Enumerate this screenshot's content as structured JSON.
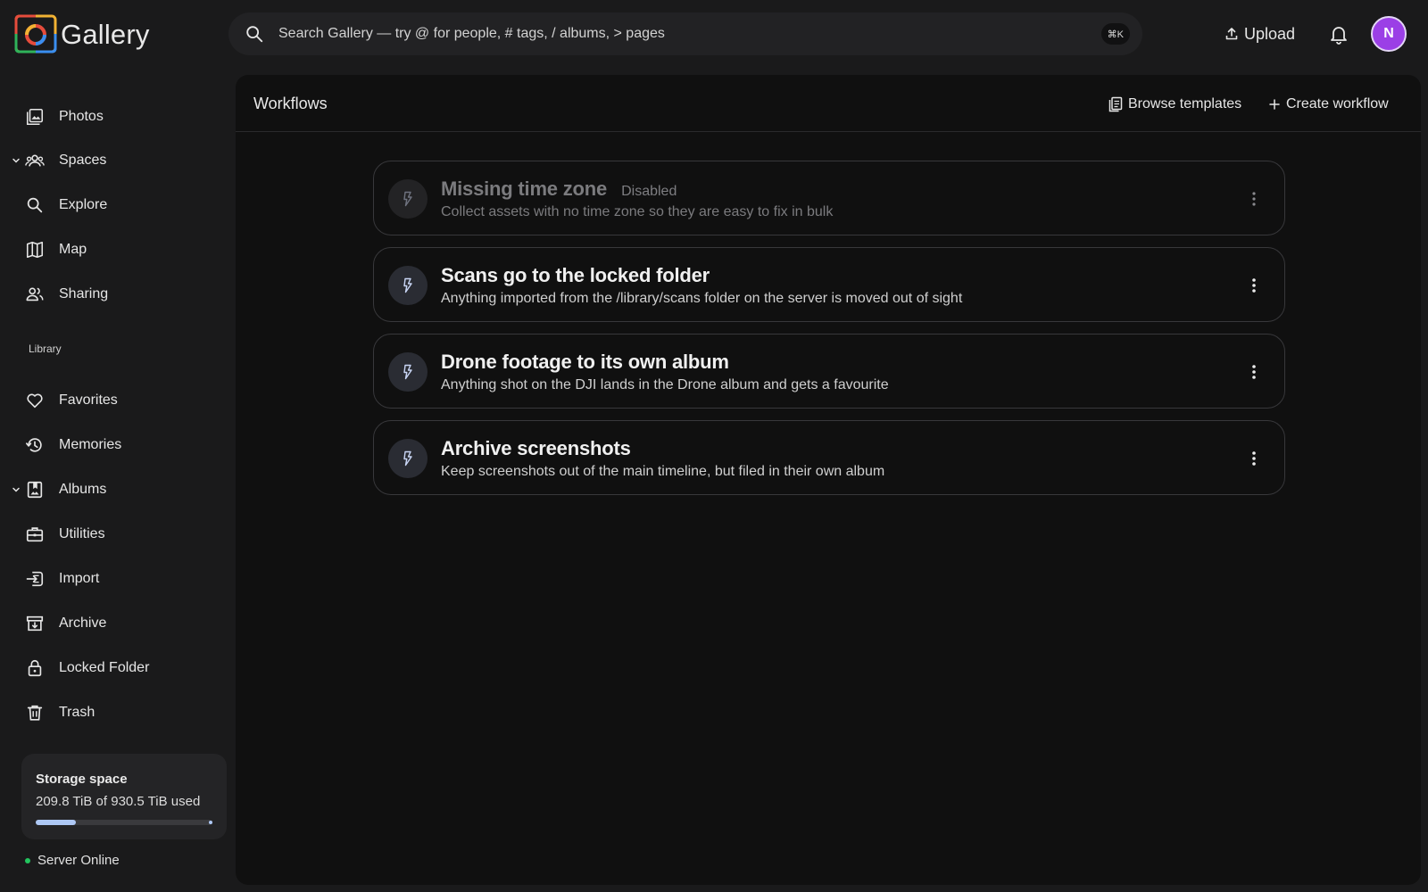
{
  "app": {
    "name": "Gallery"
  },
  "search": {
    "placeholder": "Search Gallery — try @ for people, # tags, / albums, > pages",
    "shortcut": "⌘K"
  },
  "topbar": {
    "upload_label": "Upload",
    "avatar_initial": "N"
  },
  "sidebar": {
    "items": [
      {
        "label": "Photos",
        "icon": "photos-icon"
      },
      {
        "label": "Spaces",
        "icon": "people-icon"
      },
      {
        "label": "Explore",
        "icon": "search-icon"
      },
      {
        "label": "Map",
        "icon": "map-icon"
      },
      {
        "label": "Sharing",
        "icon": "sharing-icon"
      }
    ],
    "library_label": "Library",
    "library_items": [
      {
        "label": "Favorites",
        "icon": "heart-icon"
      },
      {
        "label": "Memories",
        "icon": "history-icon"
      },
      {
        "label": "Albums",
        "icon": "album-icon"
      },
      {
        "label": "Utilities",
        "icon": "toolbox-icon"
      },
      {
        "label": "Import",
        "icon": "import-icon"
      },
      {
        "label": "Archive",
        "icon": "archive-icon"
      },
      {
        "label": "Locked Folder",
        "icon": "lock-icon"
      },
      {
        "label": "Trash",
        "icon": "trash-icon"
      }
    ],
    "storage": {
      "title": "Storage space",
      "used_text": "209.8 TiB of 930.5 TiB used",
      "used_fraction": 0.2255
    },
    "server_status": "Server Online"
  },
  "main": {
    "title": "Workflows",
    "browse_templates_label": "Browse templates",
    "create_workflow_label": "Create workflow",
    "workflows": [
      {
        "title": "Missing time zone",
        "badge": "Disabled",
        "description": "Collect assets with no time zone so they are easy to fix in bulk",
        "enabled": false
      },
      {
        "title": "Scans go to the locked folder",
        "badge": "",
        "description": "Anything imported from the /library/scans folder on the server is moved out of sight",
        "enabled": true
      },
      {
        "title": "Drone footage to its own album",
        "badge": "",
        "description": "Anything shot on the DJI lands in the Drone album and gets a favourite",
        "enabled": true
      },
      {
        "title": "Archive screenshots",
        "badge": "",
        "description": "Keep screenshots out of the main timeline, but filed in their own album",
        "enabled": true
      }
    ]
  },
  "colors": {
    "accent": "#9b3fe6",
    "storage_bar": "#aec8f5",
    "online": "#22c55e",
    "background": "#1a1a1b",
    "panel": "#101010"
  }
}
